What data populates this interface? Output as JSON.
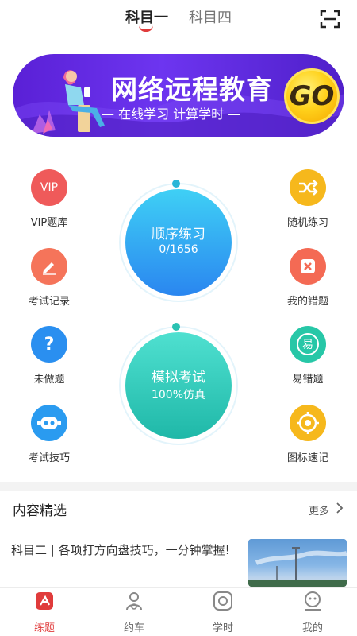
{
  "tabs": [
    {
      "label": "科目一",
      "active": true
    },
    {
      "label": "科目四",
      "active": false
    }
  ],
  "banner": {
    "title": "网络远程教育",
    "subtitle": "— 在线学习  计算学时 —",
    "go_label": "GO"
  },
  "features_left": [
    {
      "label": "VIP题库",
      "icon_text": "VIP",
      "icon": "vip-icon",
      "color": "#ef5a5a"
    },
    {
      "label": "考试记录",
      "icon": "pencil-icon",
      "color": "#f5745a"
    },
    {
      "label": "未做题",
      "icon_text": "?",
      "icon": "question-icon",
      "color": "#2a8ff0"
    },
    {
      "label": "考试技巧",
      "icon": "robot-icon",
      "color": "#2a9bf0"
    }
  ],
  "features_right": [
    {
      "label": "随机练习",
      "icon": "shuffle-icon",
      "color": "#f6b81c"
    },
    {
      "label": "我的错题",
      "icon": "wrong-icon",
      "color": "#f46a54"
    },
    {
      "label": "易错题",
      "icon_text": "易",
      "icon": "easy-wrong-icon",
      "color": "#27c7a7"
    },
    {
      "label": "图标速记",
      "icon": "target-icon",
      "color": "#f6b81c"
    }
  ],
  "sequential": {
    "title": "顺序练习",
    "progress": "0/1656",
    "color_top": "#3fd0f5",
    "color_bottom": "#2a86f0"
  },
  "mock_exam": {
    "title": "模拟考试",
    "subtitle": "100%仿真",
    "color_top": "#4fe0d0",
    "color_bottom": "#1fb8a8"
  },
  "content": {
    "section_title": "内容精选",
    "more_label": "更多",
    "article_title": "科目二 | 各项打方向盘技巧，一分钟掌握!"
  },
  "bottom_nav": [
    {
      "label": "练题",
      "icon": "practice-icon",
      "active": true
    },
    {
      "label": "约车",
      "icon": "driver-icon",
      "active": false
    },
    {
      "label": "学时",
      "icon": "clock-icon",
      "active": false
    },
    {
      "label": "我的",
      "icon": "profile-icon",
      "active": false
    }
  ],
  "colors": {
    "accent": "#e03b3b",
    "banner": "#5a20d6"
  }
}
